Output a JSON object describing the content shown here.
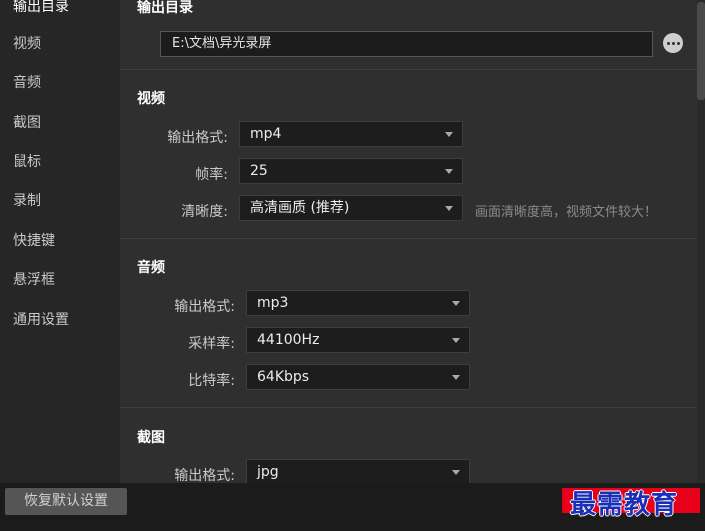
{
  "sidebar": {
    "items": [
      {
        "label": "输出目录"
      },
      {
        "label": "视频"
      },
      {
        "label": "音频"
      },
      {
        "label": "截图"
      },
      {
        "label": "鼠标"
      },
      {
        "label": "录制"
      },
      {
        "label": "快捷键"
      },
      {
        "label": "悬浮框"
      },
      {
        "label": "通用设置"
      }
    ]
  },
  "output": {
    "title": "输出目录",
    "path": "E:\\文档\\异光录屏"
  },
  "video": {
    "title": "视频",
    "format_label": "输出格式:",
    "format_value": "mp4",
    "fps_label": "帧率:",
    "fps_value": "25",
    "quality_label": "清晰度:",
    "quality_value": "高清画质 (推荐)",
    "quality_hint": "画面清晰度高，视频文件较大！"
  },
  "audio": {
    "title": "音频",
    "format_label": "输出格式:",
    "format_value": "mp3",
    "sample_label": "采样率:",
    "sample_value": "44100Hz",
    "bitrate_label": "比特率:",
    "bitrate_value": "64Kbps"
  },
  "screenshot": {
    "title": "截图",
    "format_label": "输出格式:",
    "format_value": "jpg"
  },
  "footer": {
    "restore_label": "恢复默认设置",
    "watermark": "最需教育"
  }
}
